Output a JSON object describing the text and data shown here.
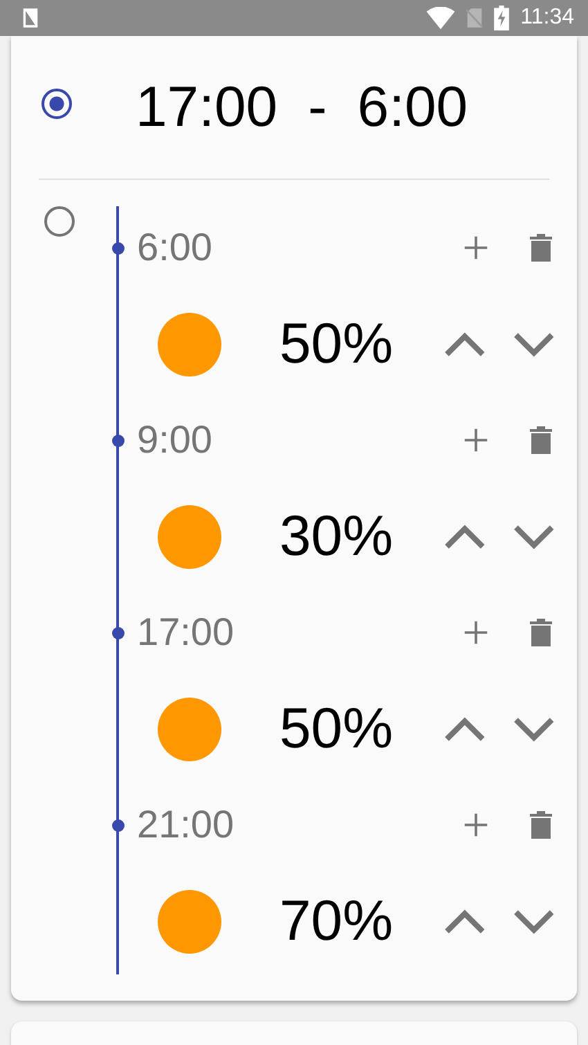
{
  "status_bar": {
    "time": "11:34"
  },
  "schedules": [
    {
      "selected": true,
      "start": "17:00",
      "separator": "-",
      "end": "6:00"
    },
    {
      "selected": false,
      "entries": [
        {
          "time": "6:00",
          "value": "50%"
        },
        {
          "time": "9:00",
          "value": "30%"
        },
        {
          "time": "17:00",
          "value": "50%"
        },
        {
          "time": "21:00",
          "value": "70%"
        }
      ]
    }
  ]
}
